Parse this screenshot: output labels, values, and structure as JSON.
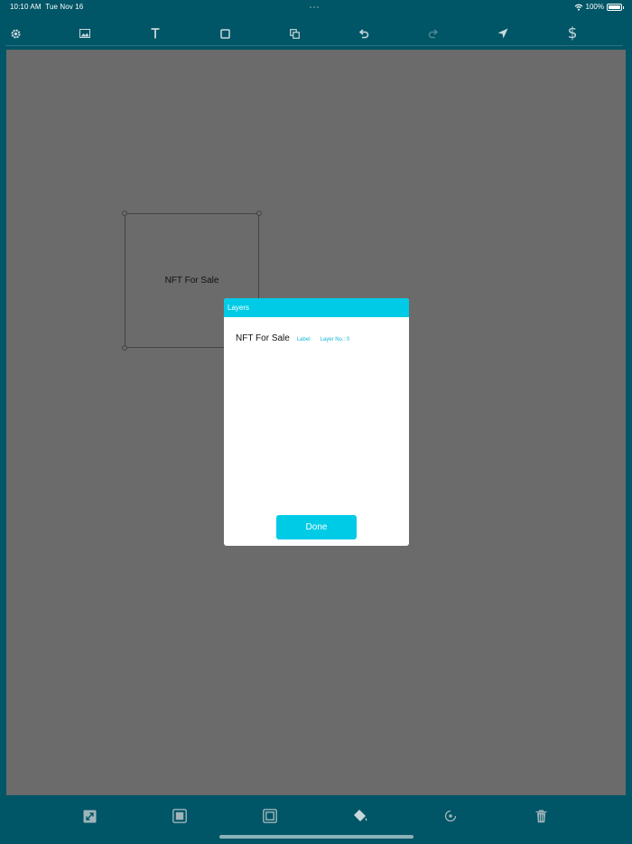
{
  "status_bar": {
    "time": "10:10 AM",
    "date": "Tue Nov 16",
    "battery": "100%"
  },
  "toolbar": {
    "icons": [
      "gear-icon",
      "image-icon",
      "text-icon",
      "shape-icon",
      "duplicate-icon",
      "undo-icon",
      "redo-icon",
      "send-icon",
      "dollar-icon"
    ]
  },
  "canvas": {
    "text_element": "NFT For Sale",
    "background_color": "#6b6b6b"
  },
  "layers_dialog": {
    "title": "Layers",
    "layers": [
      {
        "name": "NFT For Sale",
        "type": "Label",
        "layer_no": "Layer No.: 0"
      }
    ],
    "done_label": "Done",
    "accent_color": "#00cbe6"
  },
  "bottom_toolbar": {
    "icons": [
      "resize-icon",
      "bring-forward-icon",
      "send-backward-icon",
      "fill-color-icon",
      "rotate-icon",
      "trash-icon"
    ]
  }
}
